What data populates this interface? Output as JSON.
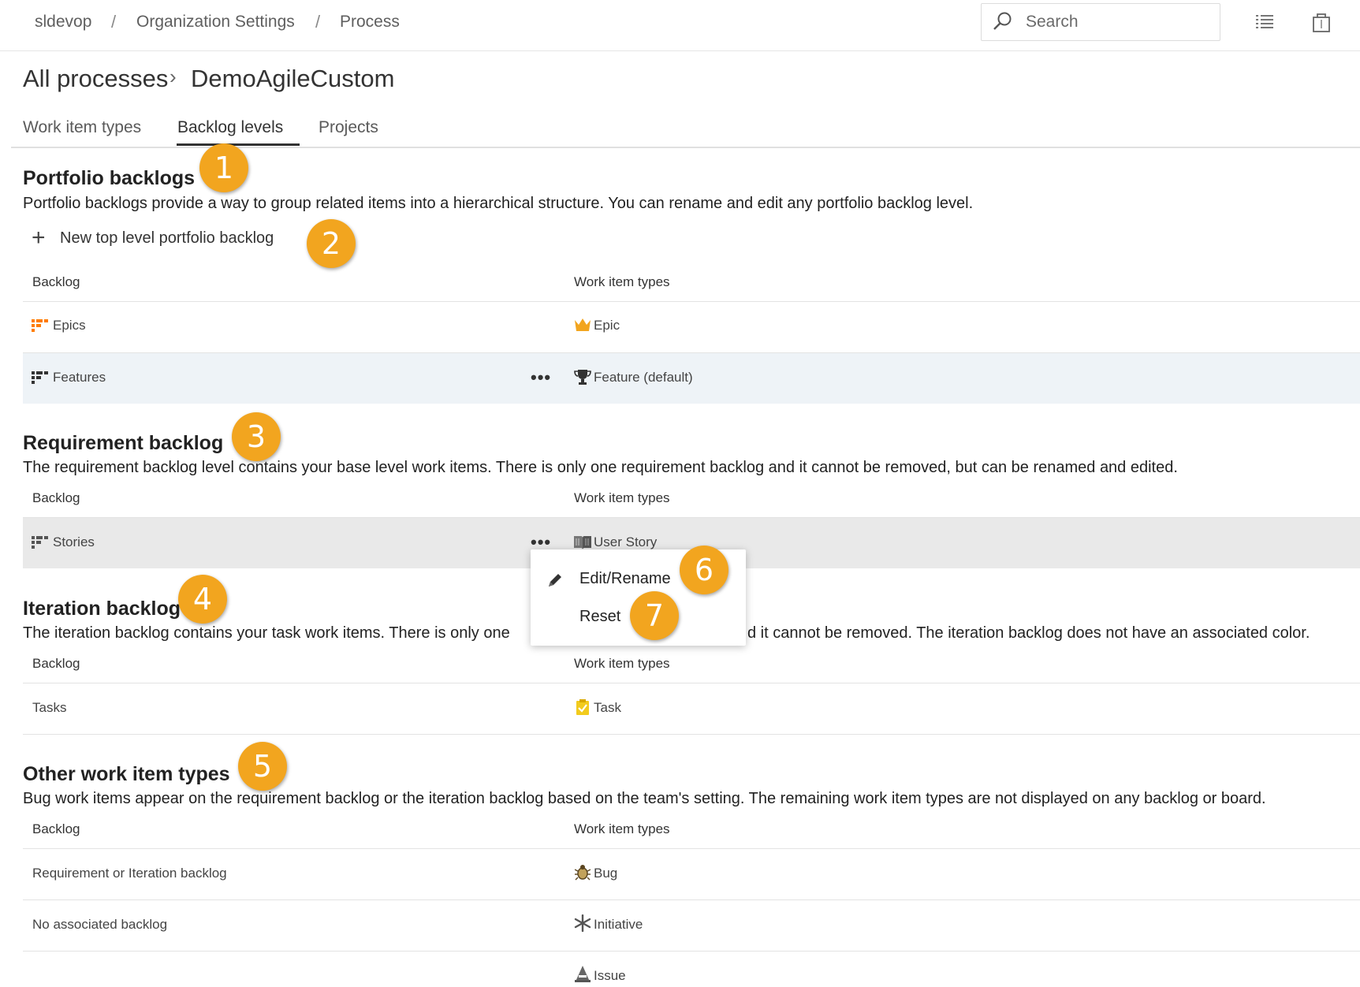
{
  "breadcrumb": {
    "org": "sldevop",
    "sep1": "/",
    "settings": "Organization Settings",
    "sep2": "/",
    "process": "Process"
  },
  "search": {
    "placeholder": "Search"
  },
  "header": {
    "all_processes": "All processes",
    "chevron": "›",
    "current": "DemoAgileCustom"
  },
  "tabs": [
    {
      "label": "Work item types",
      "active": false
    },
    {
      "label": "Backlog levels",
      "active": true
    },
    {
      "label": "Projects",
      "active": false
    }
  ],
  "portfolio": {
    "title": "Portfolio backlogs",
    "description": "Portfolio backlogs provide a way to group related items into a hierarchical structure. You can rename and edit any portfolio backlog level.",
    "add_label": "New top level portfolio backlog",
    "col_backlog": "Backlog",
    "col_types": "Work item types",
    "rows": [
      {
        "backlog": "Epics",
        "type": "Epic"
      },
      {
        "backlog": "Features",
        "type": "Feature (default)"
      }
    ]
  },
  "requirement": {
    "title": "Requirement backlog",
    "description": "The requirement backlog level contains your base level work items. There is only one requirement backlog and it cannot be removed, but can be renamed and edited.",
    "col_backlog": "Backlog",
    "col_types": "Work item types",
    "rows": [
      {
        "backlog": "Stories",
        "type": "User Story"
      }
    ]
  },
  "iteration": {
    "title": "Iteration backlog",
    "description_left": "The iteration backlog contains your task work items. There is only one",
    "description_right": "d it cannot be removed. The iteration backlog does not have an associated color.",
    "col_backlog": "Backlog",
    "col_types": "Work item types",
    "rows": [
      {
        "backlog": "Tasks",
        "type": "Task"
      }
    ]
  },
  "other": {
    "title": "Other work item types",
    "description": "Bug work items appear on the requirement backlog or the iteration backlog based on the team's setting. The remaining work item types are not displayed on any backlog or board.",
    "col_backlog": "Backlog",
    "col_types": "Work item types",
    "rows": [
      {
        "backlog": "Requirement or Iteration backlog",
        "type": "Bug"
      },
      {
        "backlog": "No associated backlog",
        "type": "Initiative"
      },
      {
        "backlog": "",
        "type": "Issue"
      }
    ]
  },
  "context_menu": {
    "edit_label": "Edit/Rename",
    "reset_label": "Reset"
  },
  "more_actions": "•••",
  "callouts": [
    "1",
    "2",
    "3",
    "4",
    "5",
    "6",
    "7"
  ],
  "colors": {
    "callout": "#f2a51f",
    "epic": "#ff7b00",
    "task": "#f2cb1d",
    "features_row_bg": "#eef3f7",
    "stories_row_bg": "#e9e9e9"
  },
  "icons": {
    "search": "search-icon",
    "list": "list-icon",
    "bag": "shopping-bag-icon",
    "plus": "plus-icon",
    "epics_backlog": "backlog-epics-icon",
    "features_backlog": "backlog-features-icon",
    "stories_backlog": "backlog-stories-icon",
    "epic": "crown-icon",
    "feature": "trophy-icon",
    "user_story": "book-icon",
    "task": "clipboard-icon",
    "bug": "bug-icon",
    "initiative": "asterisk-icon",
    "issue": "issue-icon",
    "edit": "pencil-icon"
  }
}
